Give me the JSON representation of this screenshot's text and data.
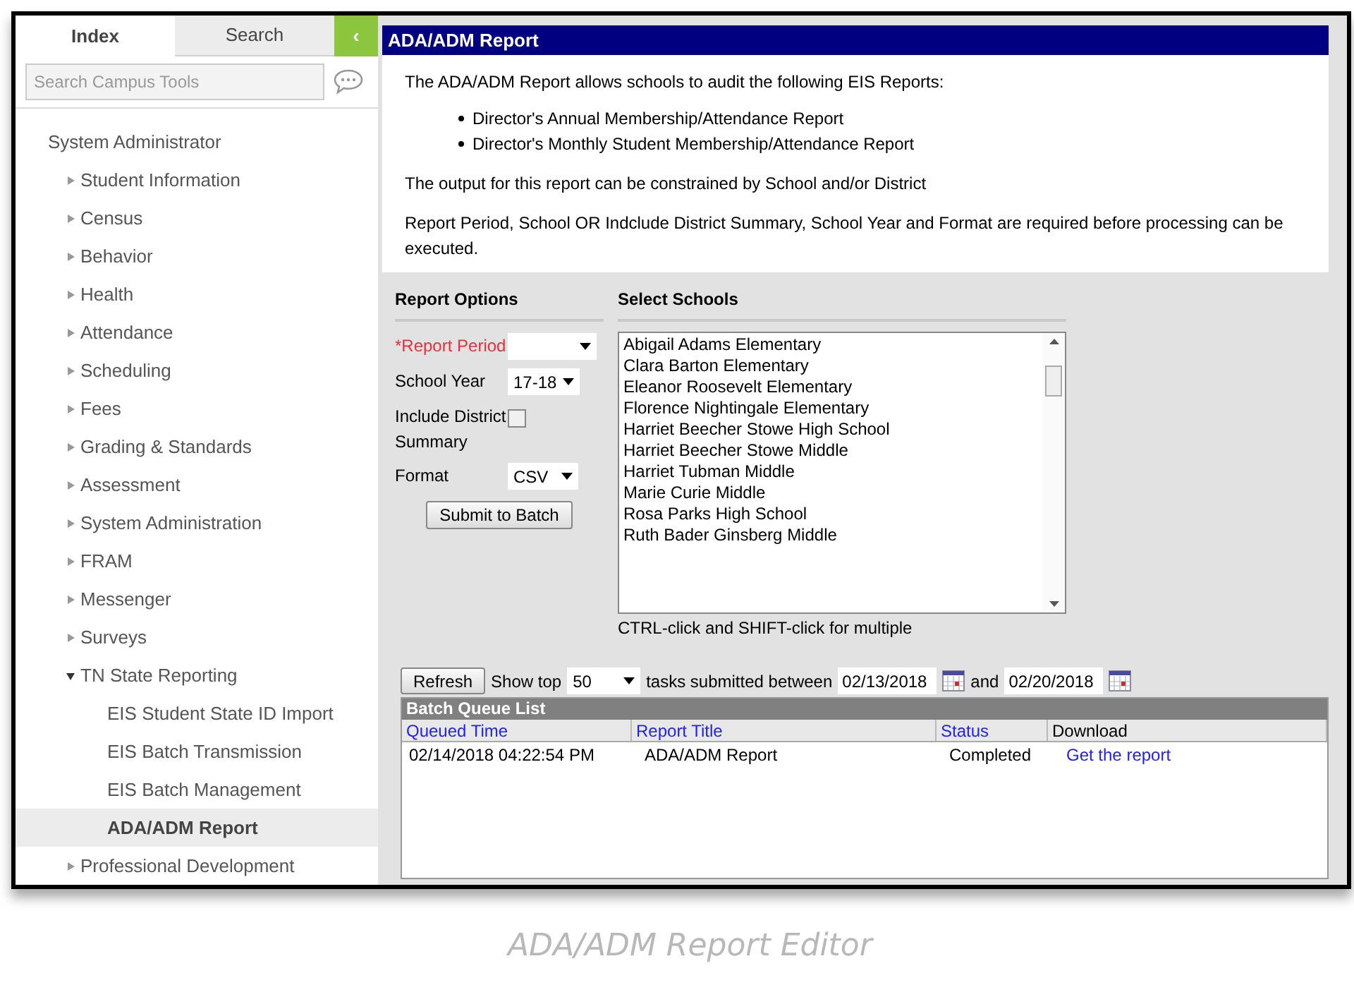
{
  "sidebar": {
    "tabs": [
      {
        "label": "Index",
        "selected": true
      },
      {
        "label": "Search",
        "selected": false
      }
    ],
    "collapse_button": "‹",
    "search": {
      "placeholder": "Search Campus Tools"
    },
    "tree": {
      "label": "System Administrator",
      "children": [
        {
          "label": "Student Information",
          "expanded": false,
          "selected": false
        },
        {
          "label": "Census",
          "expanded": false,
          "selected": false
        },
        {
          "label": "Behavior",
          "expanded": false,
          "selected": false
        },
        {
          "label": "Health",
          "expanded": false,
          "selected": false
        },
        {
          "label": "Attendance",
          "expanded": false,
          "selected": false
        },
        {
          "label": "Scheduling",
          "expanded": false,
          "selected": false
        },
        {
          "label": "Fees",
          "expanded": false,
          "selected": false
        },
        {
          "label": "Grading & Standards",
          "expanded": false,
          "selected": false
        },
        {
          "label": "Assessment",
          "expanded": false,
          "selected": false
        },
        {
          "label": "System Administration",
          "expanded": false,
          "selected": false
        },
        {
          "label": "FRAM",
          "expanded": false,
          "selected": false
        },
        {
          "label": "Messenger",
          "expanded": false,
          "selected": false
        },
        {
          "label": "Surveys",
          "expanded": false,
          "selected": false
        },
        {
          "label": "TN State Reporting",
          "expanded": true,
          "selected": false,
          "children": [
            {
              "label": "EIS Student State ID Import",
              "selected": false
            },
            {
              "label": "EIS Batch Transmission",
              "selected": false
            },
            {
              "label": "EIS Batch Management",
              "selected": false
            },
            {
              "label": "ADA/ADM Report",
              "selected": true
            }
          ]
        },
        {
          "label": "Professional Development",
          "expanded": false,
          "selected": false
        }
      ]
    }
  },
  "report": {
    "title": "ADA/ADM Report",
    "intro": "The ADA/ADM Report allows schools to audit the following EIS Reports:",
    "bullets": [
      "Director's Annual Membership/Attendance Report",
      "Director's Monthly Student Membership/Attendance Report"
    ],
    "paragraphs": [
      "The output for this report can be constrained by School and/or District",
      "Report Period, School OR Indclude District Summary, School Year and Format are required before processing can be executed."
    ]
  },
  "options": {
    "heading": "Report Options",
    "fields": [
      {
        "kind": "select",
        "label": "*Report Period",
        "required": true
      },
      {
        "kind": "select",
        "label": "School Year",
        "required": false,
        "value": "17-18"
      },
      {
        "kind": "checkbox",
        "label": "Include District Summary",
        "required": false,
        "checked": false
      },
      {
        "kind": "select",
        "label": "Format",
        "required": false,
        "value": "CSV"
      }
    ],
    "submit": "Submit to Batch"
  },
  "schools": {
    "heading": "Select Schools",
    "items": [
      "Abigail Adams Elementary",
      "Clara Barton Elementary",
      "Eleanor Roosevelt Elementary",
      "Florence Nightingale Elementary",
      "Harriet Beecher Stowe High School",
      "Harriet Beecher Stowe Middle",
      "Harriet Tubman Middle",
      "Marie Curie Middle",
      "Rosa Parks High School",
      "Ruth Bader Ginsberg Middle"
    ],
    "hint": "CTRL-click and SHIFT-click for multiple"
  },
  "queue": {
    "refresh": "Refresh",
    "show_top": "Show top",
    "count": "50",
    "between": "tasks submitted between",
    "start": "02/13/2018",
    "and": "and",
    "end": "02/20/2018",
    "title": "Batch Queue List",
    "columns": [
      {
        "label": "Queued Time",
        "sortable": true
      },
      {
        "label": "Report Title",
        "sortable": true
      },
      {
        "label": "Status",
        "sortable": true
      },
      {
        "label": "Download",
        "sortable": false
      }
    ],
    "rows": [
      {
        "queued_time": "02/14/2018 04:22:54 PM",
        "report_title": "ADA/ADM Report",
        "status": "Completed",
        "download": "Get the report"
      }
    ]
  },
  "caption": "ADA/ADM Report Editor"
}
